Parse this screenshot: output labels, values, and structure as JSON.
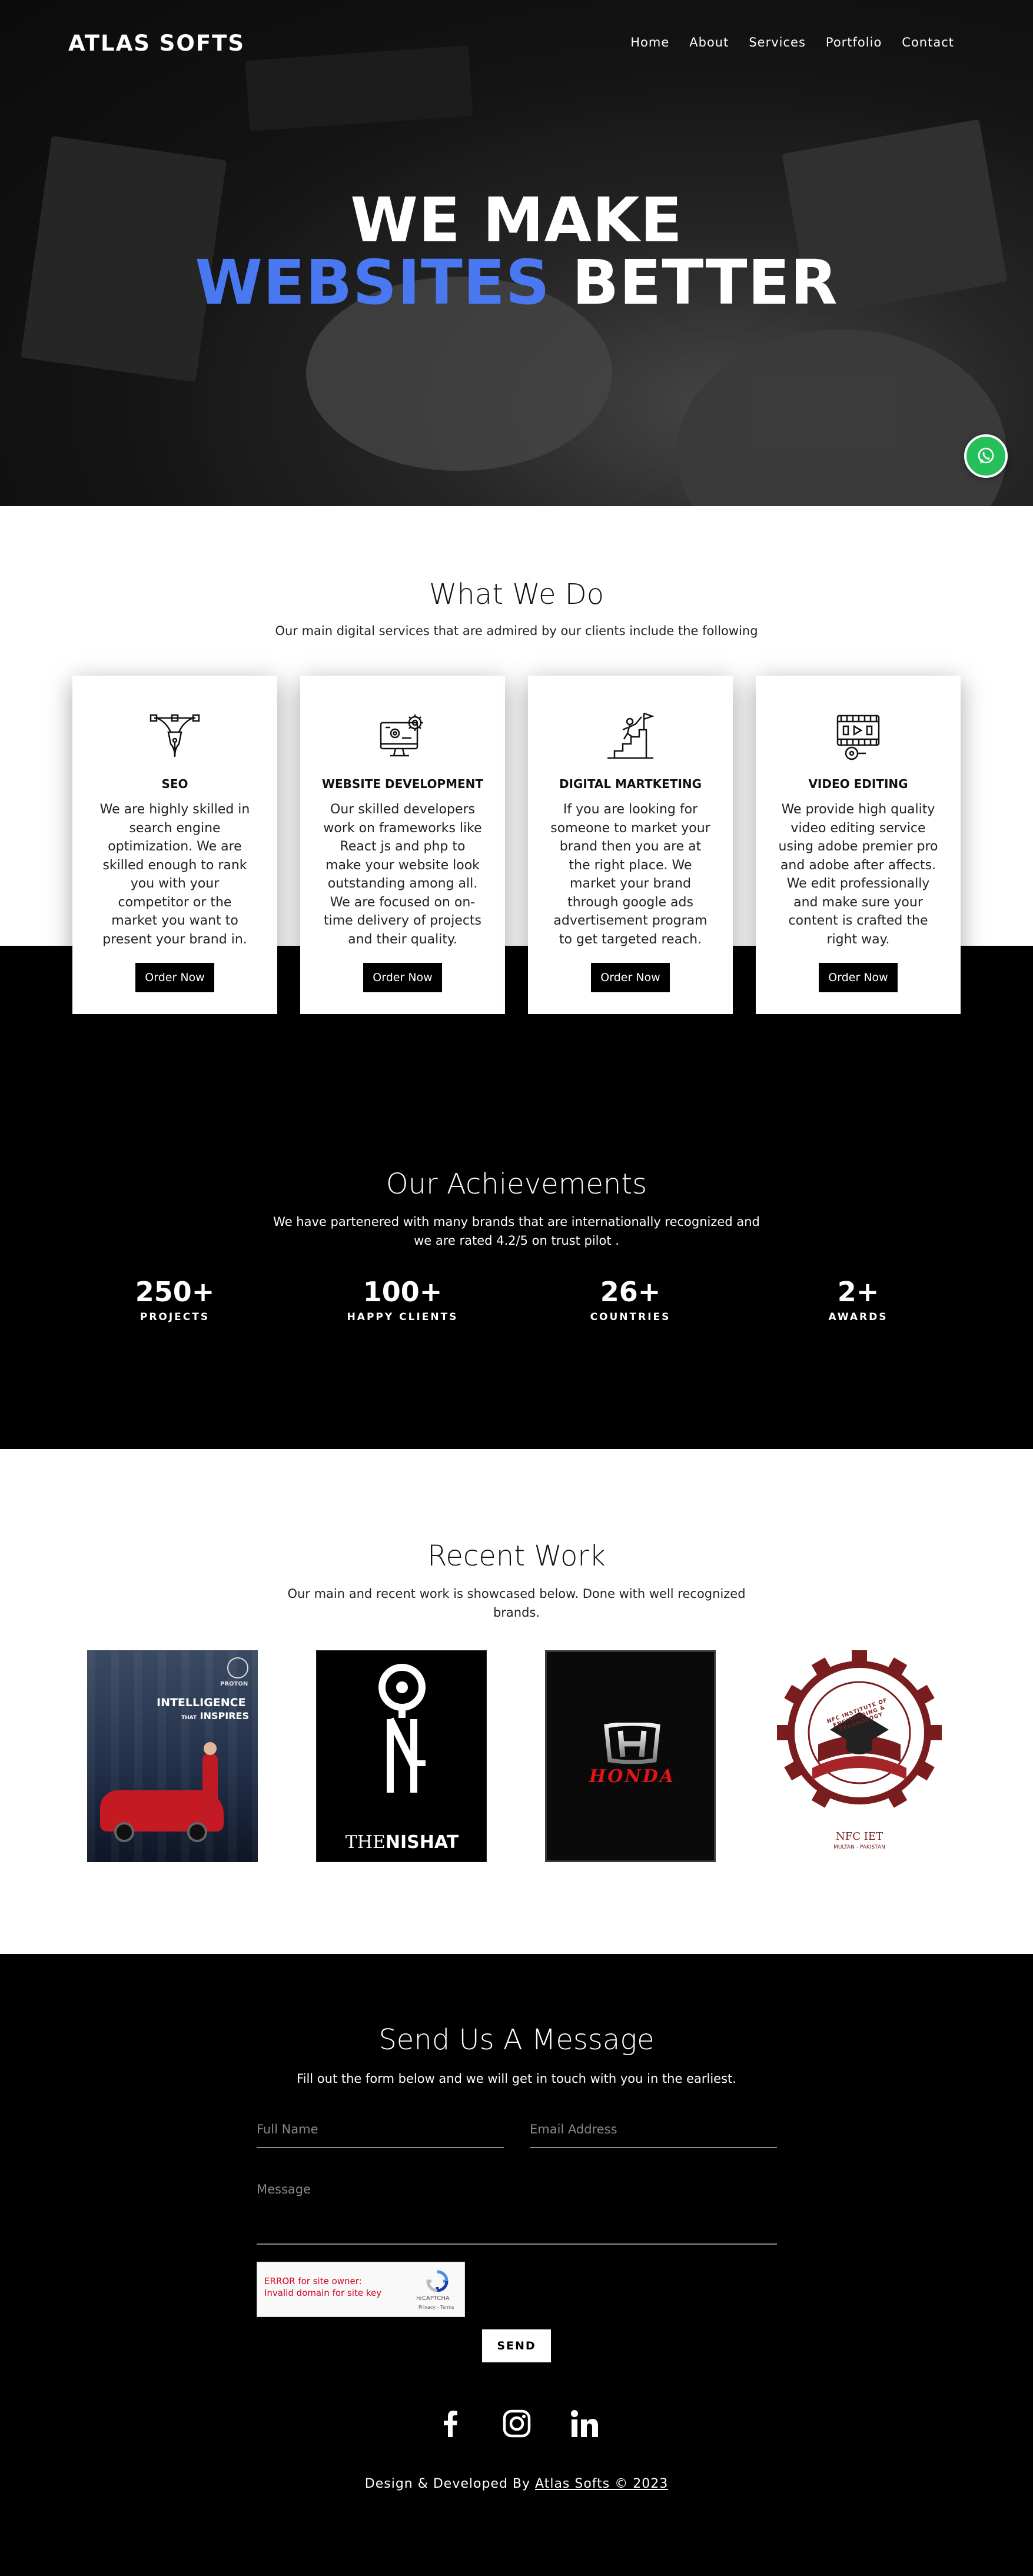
{
  "brand": {
    "name": "ATLAS SOFTS"
  },
  "nav": {
    "items": [
      "Home",
      "About",
      "Services",
      "Portfolio",
      "Contact"
    ]
  },
  "hero": {
    "line1": "WE MAKE",
    "line2_highlight": "WEBSITES",
    "line2_rest": "BETTER",
    "accent_color": "#4a78f0"
  },
  "whatsapp": {
    "icon": "whatsapp-icon",
    "color": "#25c05a"
  },
  "what_we_do": {
    "title": "What We Do",
    "subtitle": "Our main digital services that are admired by our clients include the following",
    "cards": [
      {
        "icon": "pen-tool-icon",
        "title": "SEO",
        "description": "We are highly skilled in search engine optimization. We are skilled enough to rank you with your competitor or the market you want to present your brand in.",
        "button": "Order Now"
      },
      {
        "icon": "monitor-gear-icon",
        "title": "WEBSITE DEVELOPMENT",
        "description": "Our skilled developers work on frameworks like React js and php to make your website look outstanding among all. We are focused on on-time delivery of projects and their quality.",
        "button": "Order Now"
      },
      {
        "icon": "growth-flag-icon",
        "title": "DIGITAL MARTKETING",
        "description": "If you are looking for someone to market your brand then you are at the right place. We market your brand through google ads advertisement program to get targeted reach.",
        "button": "Order Now"
      },
      {
        "icon": "video-reel-icon",
        "title": "VIDEO EDITING",
        "description": "We provide high quality video editing service using adobe premier pro and adobe after affects. We edit professionally and make sure your content is crafted the right way.",
        "button": "Order Now"
      }
    ]
  },
  "achievements": {
    "title": "Our Achievements",
    "subtitle_line1": "We have partenered with many brands that are internationally recognized and",
    "subtitle_line2": "we are rated 4.2/5 on trust pilot .",
    "stats": [
      {
        "value": "250+",
        "label": "PROJECTS"
      },
      {
        "value": "100+",
        "label": "HAPPY CLIENTS"
      },
      {
        "value": "26+",
        "label": "COUNTRIES"
      },
      {
        "value": "2+",
        "label": "AWARDS"
      }
    ]
  },
  "recent_work": {
    "title": "Recent Work",
    "subtitle_line1": "Our main and recent work is showcased below. Done with well recognized",
    "subtitle_line2": "brands.",
    "items": [
      {
        "brand": "PROTON",
        "headline1": "INTELLIGENCE",
        "headline2a": "THAT",
        "headline2b": "INSPIRES"
      },
      {
        "brand": "THE NISHAT",
        "word1": "THE",
        "word2": "NISHAT"
      },
      {
        "brand": "HONDA"
      },
      {
        "brand": "NFC IET",
        "ring_text": "NFC INSTITUTE OF ENGINEERING & TECHNOLOGY",
        "sub": "MULTAN - PAKISTAN"
      }
    ]
  },
  "contact": {
    "title": "Send Us A Message",
    "subtitle": "Fill out the form below and we will get in touch with you in the earliest.",
    "full_name_placeholder": "Full Name",
    "email_placeholder": "Email Address",
    "message_placeholder": "Message",
    "captcha_error_line1": "ERROR for site owner:",
    "captcha_error_line2": "Invalid domain for site key",
    "captcha_brand": "reCAPTCHA",
    "captcha_links": "Privacy - Terms",
    "send_label": "SEND"
  },
  "social": {
    "icons": [
      "facebook-icon",
      "instagram-icon",
      "linkedin-icon"
    ]
  },
  "footer": {
    "prefix": "Design & Developed By",
    "link": "Atlas Softs © 2023"
  }
}
